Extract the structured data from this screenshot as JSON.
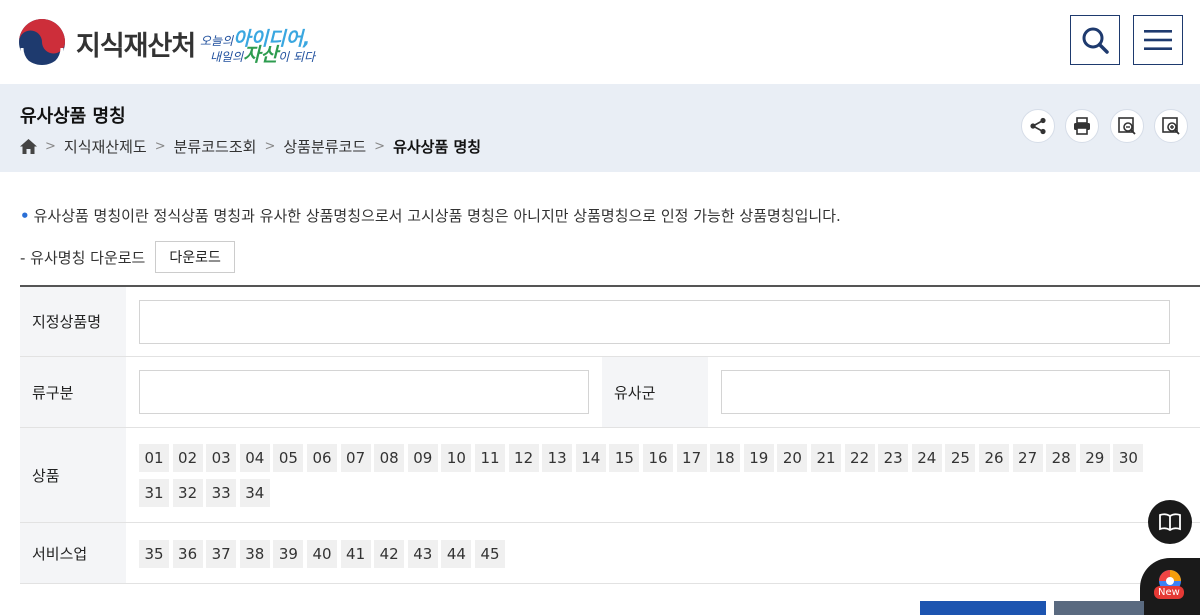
{
  "header": {
    "logo_text": "지식재산처",
    "slogan_line1_a": "오늘의",
    "slogan_line1_b": "아이디어,",
    "slogan_line2_a": "내일의",
    "slogan_line2_b": "자산",
    "slogan_line2_c": "이 되다",
    "brand_blue": "#1e3a6e",
    "brand_red": "#cd2e3a"
  },
  "page": {
    "title": "유사상품 명칭",
    "breadcrumb": [
      "지식재산제도",
      "분류코드조회",
      "상품분류코드",
      "유사상품 명칭"
    ]
  },
  "content": {
    "description": "유사상품 명칭이란 정식상품 명칭과 유사한 상품명칭으로서 고시상품 명칭은 아니지만 상품명칭으로 인정 가능한 상품명칭입니다.",
    "download_label": "- 유사명칭 다운로드",
    "download_button": "다운로드"
  },
  "form": {
    "designated_name_label": "지정상품명",
    "class_label": "류구분",
    "similar_group_label": "유사군",
    "goods_label": "상품",
    "service_label": "서비스업",
    "goods_codes": [
      "01",
      "02",
      "03",
      "04",
      "05",
      "06",
      "07",
      "08",
      "09",
      "10",
      "11",
      "12",
      "13",
      "14",
      "15",
      "16",
      "17",
      "18",
      "19",
      "20",
      "21",
      "22",
      "23",
      "24",
      "25",
      "26",
      "27",
      "28",
      "29",
      "30",
      "31",
      "32",
      "33",
      "34"
    ],
    "service_codes": [
      "35",
      "36",
      "37",
      "38",
      "39",
      "40",
      "41",
      "42",
      "43",
      "44",
      "45"
    ]
  },
  "floating": {
    "new_badge": "New"
  }
}
